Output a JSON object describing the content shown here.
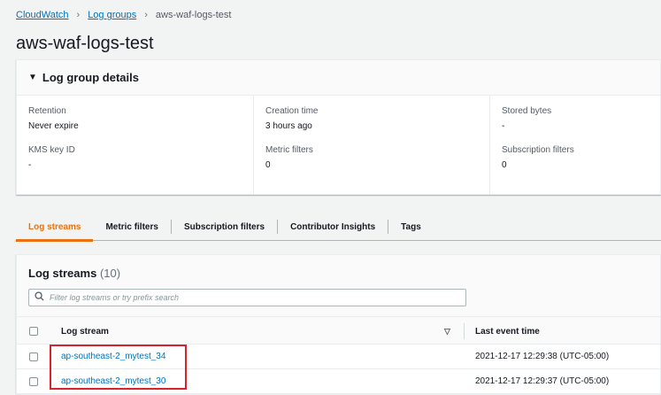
{
  "breadcrumb": {
    "items": [
      "CloudWatch",
      "Log groups"
    ],
    "current": "aws-waf-logs-test"
  },
  "page": {
    "title": "aws-waf-logs-test"
  },
  "details": {
    "heading": "Log group details",
    "retention": {
      "label": "Retention",
      "value": "Never expire"
    },
    "kms": {
      "label": "KMS key ID",
      "value": "-"
    },
    "creation": {
      "label": "Creation time",
      "value": "3 hours ago"
    },
    "metric": {
      "label": "Metric filters",
      "value": "0"
    },
    "stored": {
      "label": "Stored bytes",
      "value": "-"
    },
    "subscription": {
      "label": "Subscription filters",
      "value": "0"
    }
  },
  "tabs": [
    "Log streams",
    "Metric filters",
    "Subscription filters",
    "Contributor Insights",
    "Tags"
  ],
  "streams": {
    "title": "Log streams",
    "count": "(10)",
    "search_placeholder": "Filter log streams or try prefix search",
    "col_stream": "Log stream",
    "col_time": "Last event time",
    "rows": [
      {
        "name": "ap-southeast-2_mytest_34",
        "time": "2021-12-17 12:29:38 (UTC-05:00)"
      },
      {
        "name": "ap-southeast-2_mytest_30",
        "time": "2021-12-17 12:29:37 (UTC-05:00)"
      }
    ]
  },
  "colors": {
    "link": "#0073bb",
    "active_tab": "#ec7211",
    "highlight": "#d8232a"
  },
  "icons": {
    "search": "search-icon",
    "caret": "caret-down-icon",
    "sort": "sort-down-icon"
  }
}
